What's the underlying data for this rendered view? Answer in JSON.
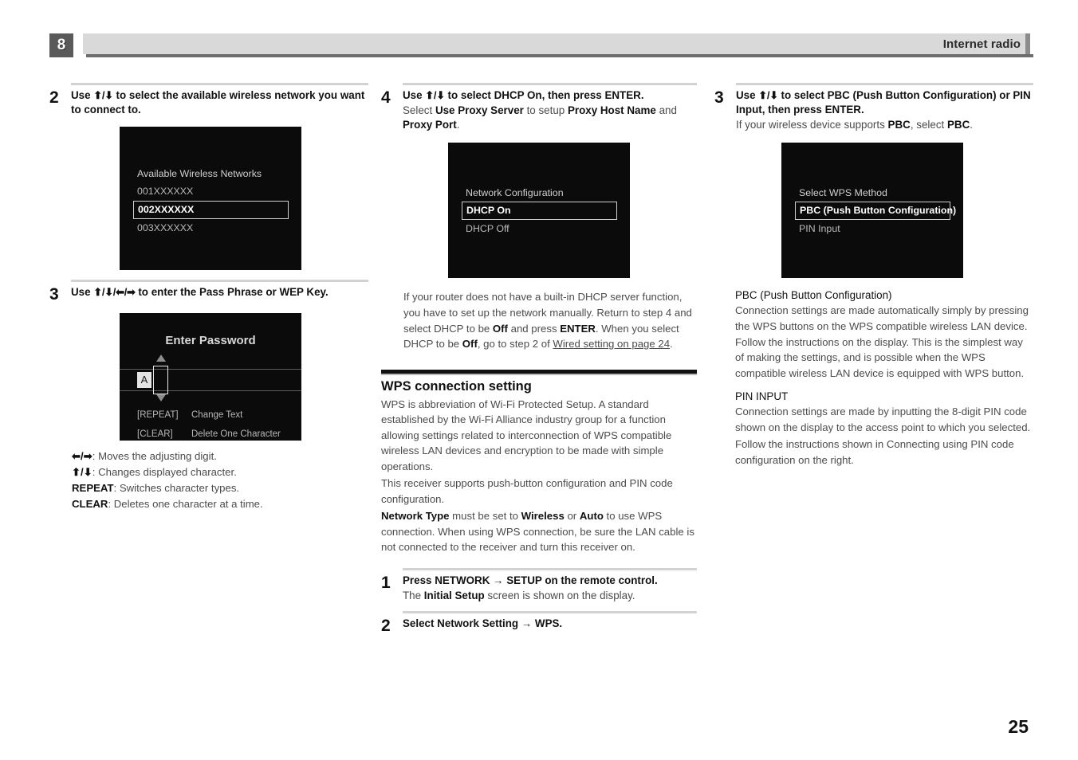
{
  "header": {
    "chapter_number": "8",
    "title": "Internet radio"
  },
  "page_number": "25",
  "column1": {
    "step2": {
      "number": "2",
      "lead_pre": "Use ",
      "arrows": "⬆/⬇",
      "lead_post": " to select the available wireless network you want to connect to."
    },
    "osd_network_list": {
      "title": "Available Wireless Networks",
      "items": [
        {
          "label": "001XXXXXX",
          "selected": false
        },
        {
          "label": "002XXXXXX",
          "selected": true
        },
        {
          "label": "003XXXXXX",
          "selected": false
        }
      ]
    },
    "step3": {
      "number": "3",
      "lead_pre": "Use ",
      "arrows": "⬆/⬇/⬅/➡",
      "lead_post": " to enter the Pass Phrase or WEP Key."
    },
    "osd_password": {
      "title": "Enter Password",
      "current_char": "A",
      "legend": [
        {
          "key": "[REPEAT]",
          "action": "Change Text"
        },
        {
          "key": "[CLEAR]",
          "action": "Delete One Character"
        }
      ]
    },
    "key_legend": [
      {
        "key": "⬅/➡",
        "key_bold": false,
        "text": ": Moves the adjusting digit."
      },
      {
        "key": "⬆/⬇",
        "key_bold": false,
        "text": ": Changes displayed character."
      },
      {
        "key": "REPEAT",
        "key_bold": true,
        "text": ": Switches character types."
      },
      {
        "key": "CLEAR",
        "key_bold": true,
        "text": ": Deletes one character at a time."
      }
    ]
  },
  "column2": {
    "step4": {
      "number": "4",
      "lead_pre": "Use ",
      "arrows": "⬆/⬇",
      "lead_post": " to select DHCP On, then press ENTER.",
      "sub_1": "Select ",
      "sub_b1": "Use Proxy Server",
      "sub_2": " to setup ",
      "sub_b2": "Proxy Host Name",
      "sub_3": " and ",
      "sub_b3": "Proxy Port",
      "sub_4": "."
    },
    "osd_network_config": {
      "title": "Network Configuration",
      "items": [
        {
          "label": "DHCP On",
          "selected": true
        },
        {
          "label": "DHCP Off",
          "selected": false
        }
      ]
    },
    "dhcp_note": {
      "p1": "If your router does not have a built-in DHCP server function, you have to set up the network manually. Return to step 4 and select DHCP to be ",
      "b1": "Off",
      "p2": " and press ",
      "b2": "ENTER",
      "p3": ". When you select DHCP to be ",
      "b3": "Off",
      "p4": ", go to step 2 of ",
      "link": "Wired setting on page 24",
      "p5": "."
    },
    "wps_section": {
      "title": "WPS connection setting",
      "p1": "WPS is abbreviation of Wi-Fi Protected Setup. A standard established by the Wi-Fi Alliance industry group for a function allowing settings related to interconnection of WPS compatible wireless LAN devices and encryption to be made with simple operations.",
      "p2": "This receiver supports push-button configuration and PIN code configuration.",
      "p3_b1": "Network Type",
      "p3_t1": " must be set to ",
      "p3_b2": "Wireless",
      "p3_t2": " or ",
      "p3_b3": "Auto",
      "p3_t3": " to use WPS connection. When using WPS connection, be sure the LAN cable is not connected to the receiver and turn this receiver on."
    },
    "wps_step1": {
      "number": "1",
      "lead": "Press NETWORK → SETUP on the remote control.",
      "sub_1": "The ",
      "sub_b1": "Initial Setup",
      "sub_2": " screen is shown on the display."
    },
    "wps_step2": {
      "number": "2",
      "lead": "Select Network Setting → WPS."
    }
  },
  "column3": {
    "step3": {
      "number": "3",
      "lead_pre": "Use ",
      "arrows": "⬆/⬇",
      "lead_post": " to select PBC (Push Button Configuration) or PIN Input, then press ENTER.",
      "sub_1": "If your wireless device supports ",
      "sub_b1": "PBC",
      "sub_2": ", select ",
      "sub_b2": "PBC",
      "sub_3": "."
    },
    "osd_wps_method": {
      "title": "Select WPS Method",
      "items": [
        {
          "label": "PBC (Push Button Configuration)",
          "selected": true
        },
        {
          "label": "PIN Input",
          "selected": false
        }
      ]
    },
    "pbc_section": {
      "heading": "PBC (Push Button Configuration)",
      "body": "Connection settings are made automatically simply by pressing the WPS buttons on the WPS compatible wireless LAN device. Follow the instructions on the display. This is the simplest way of making the settings, and is possible when the WPS compatible wireless LAN device is equipped with WPS button."
    },
    "pin_section": {
      "heading": "PIN INPUT",
      "body1": "Connection settings are made by inputting the 8-digit PIN code shown on the display to the access point to which you selected.",
      "body2": "Follow the instructions shown in Connecting using PIN code configuration on the right."
    }
  },
  "colors": {
    "chapter_tab": "#5a5a5a",
    "header_bar": "#d9d9d9",
    "osd_bg": "#0b0b0b",
    "rule_gray": "#d2d2d2"
  }
}
